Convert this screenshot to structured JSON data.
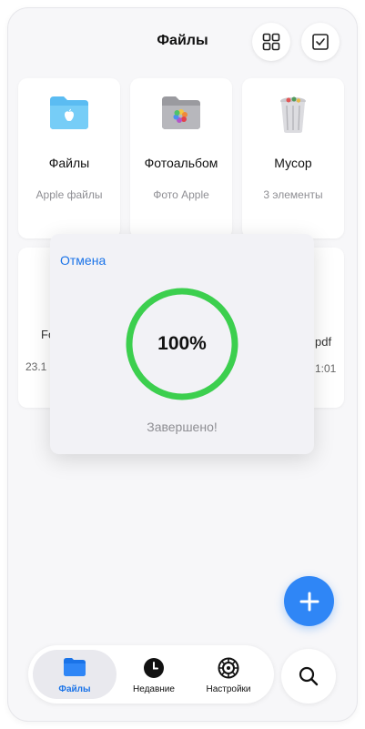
{
  "header": {
    "title": "Файлы"
  },
  "cards": [
    {
      "name": "Файлы",
      "sub": "Apple файлы"
    },
    {
      "name": "Фотоальбом",
      "sub": "Фото Apple"
    },
    {
      "name": "Мусор",
      "sub": "3 элементы"
    }
  ],
  "background_peek": {
    "left_name": "Fo",
    "left_sub": "23.1",
    "right_name": "pdf",
    "right_sub": "1:01"
  },
  "dialog": {
    "cancel_label": "Отмена",
    "progress_text": "100%",
    "progress_fraction": 1.0,
    "status_text": "Завершено!"
  },
  "tabs": [
    {
      "label": "Файлы",
      "icon": "folder-icon",
      "active": true
    },
    {
      "label": "Недавние",
      "icon": "clock-icon",
      "active": false
    },
    {
      "label": "Настройки",
      "icon": "gear-icon",
      "active": false
    }
  ],
  "colors": {
    "accent": "#2f86f6",
    "progress_ring": "#3ccf4e",
    "active_tab_text": "#1a73e8"
  }
}
